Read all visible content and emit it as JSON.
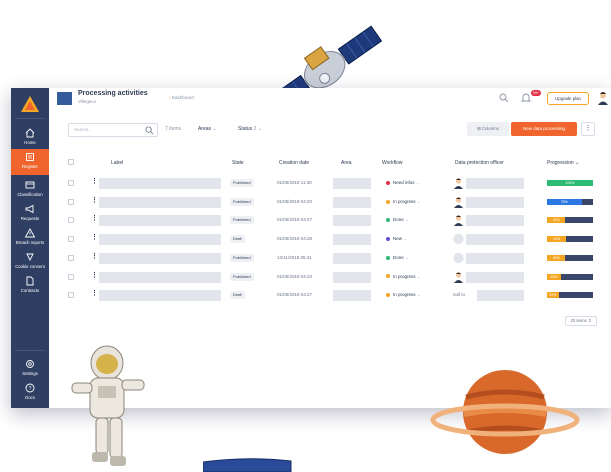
{
  "sidebar": {
    "items": [
      {
        "label": "Home",
        "icon": "home-icon"
      },
      {
        "label": "Register",
        "icon": "register-icon",
        "active": true
      },
      {
        "label": "Classification",
        "icon": "classification-icon"
      },
      {
        "label": "Requests",
        "icon": "megaphone-icon"
      },
      {
        "label": "Breach reports",
        "icon": "warning-icon"
      },
      {
        "label": "Cookie consent",
        "icon": "cookie-icon"
      },
      {
        "label": "Contracts",
        "icon": "contract-icon"
      }
    ],
    "bottom": [
      {
        "label": "Settings",
        "icon": "gear-icon"
      },
      {
        "label": "Docs",
        "icon": "help-icon"
      }
    ]
  },
  "header": {
    "title": "Processing activities",
    "subtitle": "Villegeco",
    "back_label": "Dashboard",
    "badge": "99+",
    "upgrade_label": "Upgrade plan"
  },
  "toolbar": {
    "search_placeholder": "Search...",
    "items_count": "7 items",
    "areas_label": "Areas",
    "status_label": "Status",
    "status_count": "2",
    "columns_label": "Columns",
    "new_label": "New data processing"
  },
  "table": {
    "headers": {
      "label": "Label",
      "state": "State",
      "creation_date": "Creation date",
      "area": "Area",
      "workflow": "Workflow",
      "dpo": "Data protection officer",
      "progression": "Progression"
    },
    "rows": [
      {
        "state": "Published",
        "date": "01/05/2019 11:30",
        "workflow": "Need infos",
        "wf_color": "#e5304a",
        "dpo": "avatar",
        "progress": 100,
        "progress_label": "100%",
        "progress_color": "#2dbb73"
      },
      {
        "state": "Published",
        "date": "01/05/2019 04:20",
        "workflow": "In progress",
        "wf_color": "#f5a623",
        "dpo": "avatar",
        "progress": 75,
        "progress_label": "75%",
        "progress_color": "#2b78e4"
      },
      {
        "state": "Published",
        "date": "01/05/2019 04:27",
        "workflow": "Done",
        "wf_color": "#2dbb73",
        "dpo": "avatar",
        "progress": 40,
        "progress_label": "40%",
        "progress_color": "#f5a623"
      },
      {
        "state": "Draft",
        "date": "01/05/2019 04:28",
        "workflow": "New",
        "wf_color": "#6a4cd6",
        "dpo": "placeholder",
        "progress": 42,
        "progress_label": "42%",
        "progress_color": "#f5a623"
      },
      {
        "state": "Published",
        "date": "12/11/2018 05:41",
        "workflow": "Done",
        "wf_color": "#2dbb73",
        "dpo": "placeholder",
        "progress": 40,
        "progress_label": "40%",
        "progress_color": "#f5a623"
      },
      {
        "state": "Published",
        "date": "01/05/2019 04:23",
        "workflow": "In progress",
        "wf_color": "#f5a623",
        "dpo": "avatar",
        "progress": 30,
        "progress_label": "30%",
        "progress_color": "#f5a623"
      },
      {
        "state": "Draft",
        "date": "01/05/2019 04:27",
        "workflow": "In progress",
        "wf_color": "#f5a623",
        "dpo": "text",
        "dpo_text": "null to",
        "progress": 25,
        "progress_label": "25%",
        "progress_color": "#f5a623"
      }
    ]
  },
  "footer": {
    "items_per_page": "20 items"
  },
  "colors": {
    "accent": "#f0652d",
    "sidebar": "#2f3f63"
  }
}
